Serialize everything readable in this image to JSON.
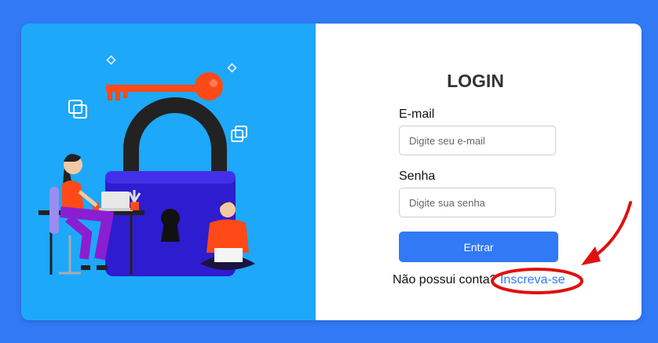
{
  "login": {
    "title": "LOGIN",
    "email_label": "E-mail",
    "email_placeholder": "Digite seu e-mail",
    "password_label": "Senha",
    "password_placeholder": "Digite sua senha",
    "submit_label": "Entrar",
    "signup_prompt": "Não possui conta?",
    "signup_link": "Inscreva-se"
  },
  "colors": {
    "page_bg": "#3179f5",
    "illustration_bg": "#1da8f9",
    "accent": "#3179f5",
    "annotation": "#e01010"
  }
}
